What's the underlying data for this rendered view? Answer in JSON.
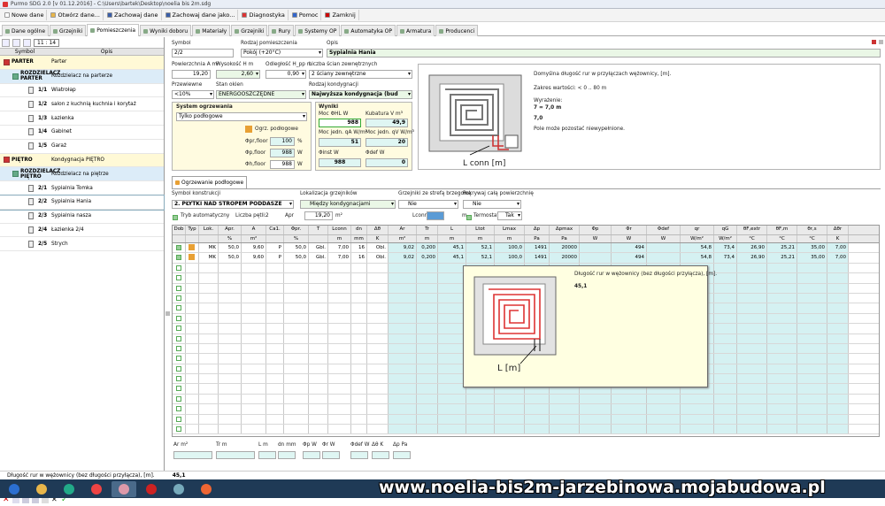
{
  "window": {
    "title": "Purmo SDG 2.0  [v 01.12.2016] - C:\\Users\\bartek\\Desktop\\noelia bis 2m.sdg"
  },
  "menu": [
    {
      "label": "Nowe dane",
      "icon": "new-doc-icon",
      "color": "#ffffff"
    },
    {
      "label": "Otwórz dane...",
      "icon": "folder-icon",
      "color": "#e8b64a"
    },
    {
      "label": "Zachowaj dane",
      "icon": "save-icon",
      "color": "#3a5ea8"
    },
    {
      "label": "Zachowaj dane jako...",
      "icon": "save-as-icon",
      "color": "#3a5ea8"
    },
    {
      "label": "Diagnostyka",
      "icon": "diagnostics-icon",
      "color": "#d33"
    },
    {
      "label": "Pomoc",
      "icon": "help-icon",
      "color": "#36c"
    },
    {
      "label": "Zamknij",
      "icon": "close-icon",
      "color": "#c00"
    }
  ],
  "tabs": [
    {
      "label": "Dane ogólne"
    },
    {
      "label": "Grzejniki"
    },
    {
      "label": "Pomieszczenia",
      "active": true
    },
    {
      "label": "Wyniki doboru"
    },
    {
      "label": "Materiały"
    },
    {
      "label": "Grzejniki"
    },
    {
      "label": "Rury"
    },
    {
      "label": "Systemy OP"
    },
    {
      "label": "Automatyka OP"
    },
    {
      "label": "Armatura"
    },
    {
      "label": "Producenci"
    }
  ],
  "left": {
    "filter": "11 : 14",
    "col_symbol": "Symbol",
    "col_ops": "Opis",
    "rows": [
      {
        "type": "lvl",
        "symbol": "PARTER",
        "desc": "Parter"
      },
      {
        "type": "dist",
        "symbol": "ROZDZIELACZ PARTER",
        "desc": "Rozdzielacz na parterze"
      },
      {
        "type": "room",
        "symbol": "1/1",
        "desc": "Wiatrołap"
      },
      {
        "type": "room",
        "symbol": "1/2",
        "desc": "salon z kuchnią kuchnia i korytaż"
      },
      {
        "type": "room",
        "symbol": "1/3",
        "desc": "Łazienka"
      },
      {
        "type": "room",
        "symbol": "1/4",
        "desc": "Gabinet"
      },
      {
        "type": "room",
        "symbol": "1/5",
        "desc": "Garaż"
      },
      {
        "type": "lvl",
        "symbol": "PIĘTRO",
        "desc": "Kondygnacja PIĘTRO"
      },
      {
        "type": "dist",
        "symbol": "ROZDZIELACZ PIĘTRO",
        "desc": "Rozdzielacz na piętrze"
      },
      {
        "type": "room",
        "symbol": "2/1",
        "desc": "Sypialnia Tomka"
      },
      {
        "type": "room",
        "symbol": "2/2",
        "desc": "Sypialnia Hania",
        "selected": true
      },
      {
        "type": "room",
        "symbol": "2/3",
        "desc": "Sypialnia nasza"
      },
      {
        "type": "room",
        "symbol": "2/4",
        "desc": "Łazienka 2/4"
      },
      {
        "type": "room",
        "symbol": "2/5",
        "desc": "Strych"
      }
    ]
  },
  "room": {
    "l_symbol": "Symbol",
    "symbol": "2/2",
    "l_kind": "Rodzaj pomieszczenia",
    "kind": "Pokój (+20°C)",
    "l_desc": "Opis",
    "desc": "Sypialnia Hania",
    "l_area": "Powierzchnia A m²",
    "area": "19,20",
    "l_height": "Wysokość H m",
    "height": "2,60",
    "l_dist": "Odległość H_pp m",
    "dist": "0,90",
    "l_walls": "Liczba ścian zewnętrznych",
    "walls": "2 ściany zewnętrzne",
    "l_perm": "Przewiewne",
    "perm": "<10%",
    "l_windows": "Stan okien",
    "windows": "ENERGOOSZCZĘDNE",
    "l_storey": "Rodzaj kondygnacji",
    "storey": "Najwyższa  kondygnacja (bud",
    "l_system": "System ogrzewania",
    "system": "Tylko podłogowe",
    "floor_heat": "Ogrz. podłogowe",
    "phi_floor_label": "Φpr,floor",
    "phi_floor": "100",
    "phi_floor_unit": "%",
    "phi_p_label": "Φp,floor",
    "phi_p": "988",
    "phi_p_unit": "W",
    "phi_h_label": "Φh,floor",
    "phi_h": "988",
    "phi_h_unit": "W",
    "results_label": "Wyniki",
    "moc_label": "Moc ΦHL W",
    "moc": "988",
    "kub_label": "Kubatura V m³",
    "kub": "49,9",
    "moc_jedn_label": "Moc jedn. qA W/m²",
    "moc_jedn": "51",
    "moc_jedn_v_label": "Moc jedn. qV W/m³",
    "moc_jedn_v": "20",
    "phi_inst_label": "Φinst W",
    "phi_inst": "988",
    "phi_def_label": "Φdef W",
    "phi_def": "0"
  },
  "help": {
    "line1": "Domyślna długość rur w przyłączach wężownicy, [m].",
    "line2": "Zakres wartości: < 0 .. 80 m",
    "line3": "Wyrażenie:",
    "line4": "7 = 7,0 m",
    "line5": "7,0",
    "line6": "Pole może pozostać niewypełnione.",
    "img_label": "L conn [m]"
  },
  "subtab": "Ogrzewanie podłogowe",
  "construction": {
    "l_type": "Symbol konstrukcji",
    "type": "2. PŁYTKI NAD STROPEM PODDASZE",
    "l_loc": "Lokalizacja grzejników",
    "loc": "Między kondygnacjami",
    "l_edge": "Grzejniki ze strefą brzegową",
    "edge": "Nie",
    "l_cover": "Pokrywaj całą powierzchnię",
    "cover": "Nie",
    "auto": "Tryb automatyczny",
    "loops_label": "Liczba pętli:",
    "loops": "2",
    "apr_label": "Apr",
    "apr": "19,20",
    "apr_unit": "m²",
    "lconn_label": "Lconn",
    "lconn_unit": "m",
    "thermostat_label": "Termostat",
    "thermostat": "Tak"
  },
  "table": {
    "headers": [
      "Dob",
      "Typ",
      "Lok.",
      "Apr.",
      "A",
      "Ca1.",
      "Φpr.",
      "T",
      "Lconn",
      "dn",
      "Δθ",
      "Ar",
      "Tr",
      "L",
      "Ltot",
      "Lmax",
      "Δp",
      "Δpmax",
      "Φp",
      "Φr",
      "Φdef",
      "qr",
      "qG",
      "θF,extr",
      "θF,m",
      "θr,s",
      "Δθr"
    ],
    "units": [
      "",
      "",
      "",
      "%",
      "m²",
      "",
      "%",
      "",
      "m",
      "mm",
      "K",
      "m²",
      "m",
      "m",
      "m",
      "m",
      "Pa",
      "Pa",
      "W",
      "W",
      "W",
      "W/m²",
      "W/m²",
      "°C",
      "°C",
      "°C",
      "K"
    ],
    "rows": [
      [
        "",
        "",
        "MK",
        "50,0",
        "9,60",
        "P",
        "50,0",
        "Gbl.",
        "7,00",
        "16",
        "Obl.",
        "9,02",
        "0,200",
        "45,1",
        "52,1",
        "100,0",
        "1491",
        "20000",
        "",
        "494",
        "",
        "54,8",
        "73,4",
        "26,90",
        "25,21",
        "35,00",
        "7,00"
      ],
      [
        "",
        "",
        "MK",
        "50,0",
        "9,60",
        "P",
        "50,0",
        "Gbl.",
        "7,00",
        "16",
        "Obl.",
        "9,02",
        "0,200",
        "45,1",
        "52,1",
        "100,0",
        "1491",
        "20000",
        "",
        "494",
        "",
        "54,8",
        "73,4",
        "26,90",
        "25,21",
        "35,00",
        "7,00"
      ]
    ]
  },
  "tooltip": {
    "title": "Długość rur w wężownicy (bez długości przyłącza), [m].",
    "value": "45,1",
    "img_label": "L [m]"
  },
  "bottom": {
    "labels": [
      "Ar m²",
      "Tr m",
      "L m",
      "dn mm",
      "Φp W",
      "Φr W",
      "Φdef W",
      "Δθ K",
      "Δp Pa"
    ]
  },
  "status": {
    "text": "Długość rur w wężownicy (bez długości przyłącza), [m].",
    "value": "45,1"
  },
  "watermark": "www.noelia-bis2m-jarzebinowa.mojabudowa.pl",
  "taskbar": [
    {
      "icon": "start-icon",
      "color": "#2b6fd1"
    },
    {
      "icon": "explorer-icon",
      "color": "#e8b64a"
    },
    {
      "icon": "media-icon",
      "color": "#2a8"
    },
    {
      "icon": "chrome-icon",
      "color": "#e44"
    },
    {
      "icon": "sdg-icon",
      "color": "#d9a"
    },
    {
      "icon": "pdf-icon",
      "color": "#c22"
    },
    {
      "icon": "paint-icon",
      "color": "#7ab"
    },
    {
      "icon": "office-icon",
      "color": "#e63"
    }
  ]
}
